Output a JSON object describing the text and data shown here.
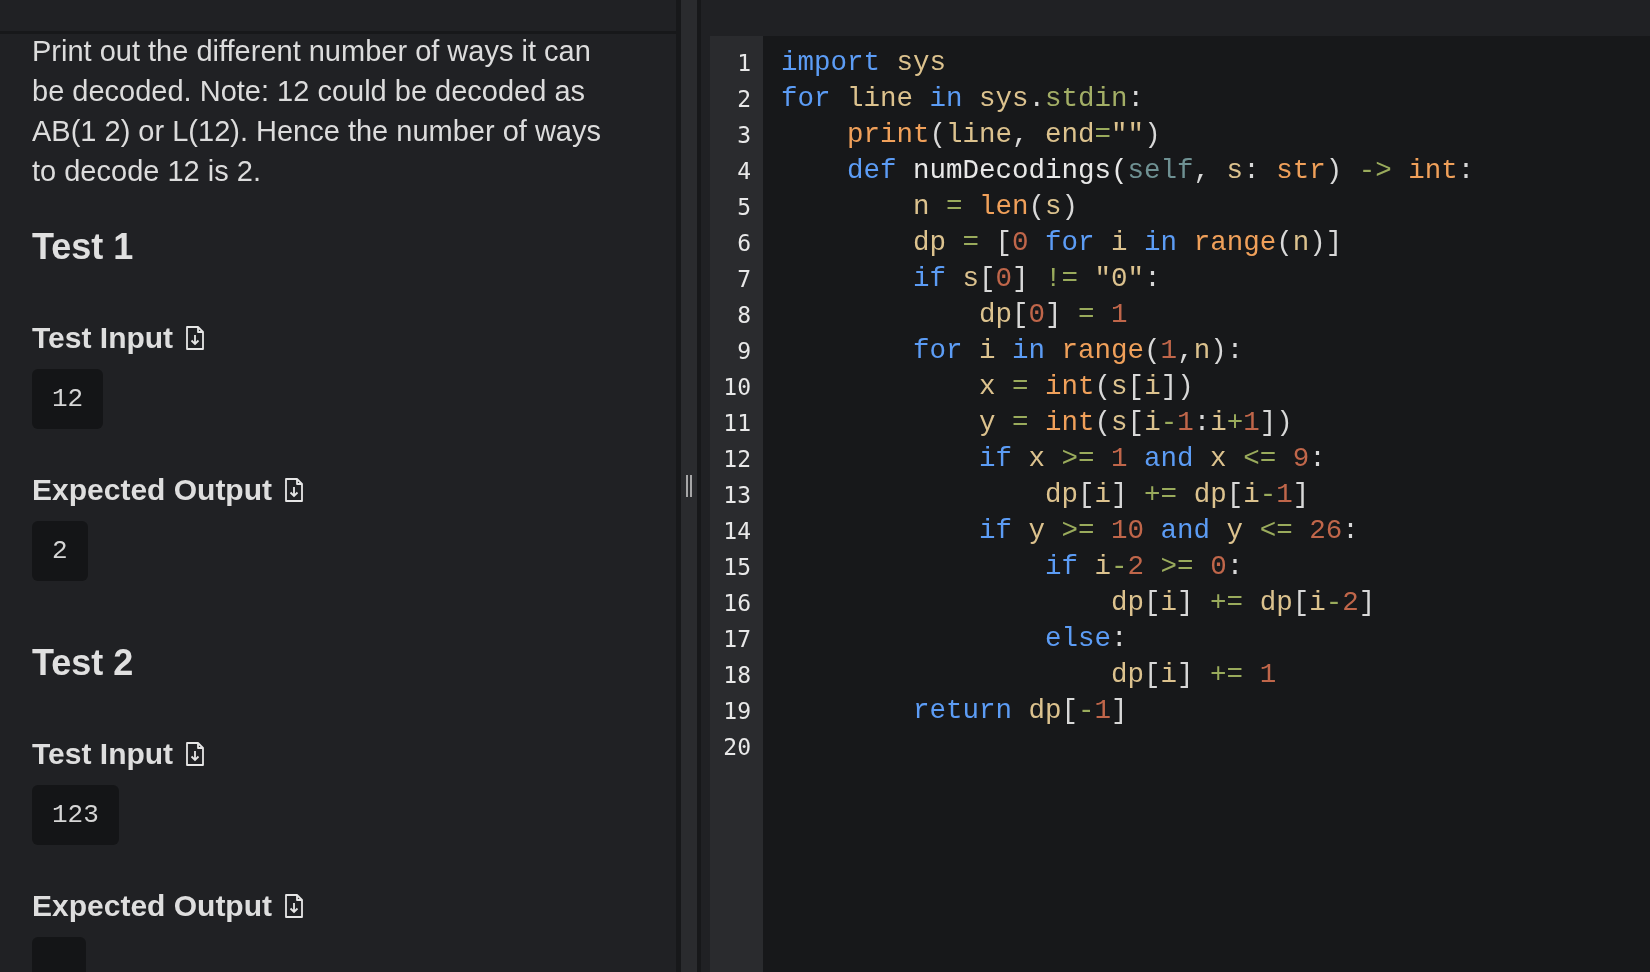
{
  "description": "Print out the different number of ways it can be decoded. Note: 12 could be decoded as AB(1 2) or L(12). Hence the number of ways to decode 12 is 2.",
  "tests": [
    {
      "title": "Test 1",
      "input_label": "Test Input",
      "input": "12",
      "output_label": "Expected Output",
      "output": "2"
    },
    {
      "title": "Test 2",
      "input_label": "Test Input",
      "input": "123",
      "output_label": "Expected Output"
    }
  ],
  "editor": {
    "lines": [
      {
        "number": "1",
        "tokens": [
          {
            "kind": "kw",
            "text": "import"
          },
          {
            "kind": "var",
            "text": " sys"
          }
        ]
      },
      {
        "number": "2",
        "tokens": [
          {
            "kind": "kw",
            "text": "for"
          },
          {
            "kind": "var",
            "text": " line"
          },
          {
            "kind": "kw",
            "text": " in"
          },
          {
            "kind": "var",
            "text": " sys"
          },
          {
            "kind": "punc",
            "text": "."
          },
          {
            "kind": "attr",
            "text": "stdin"
          },
          {
            "kind": "punc",
            "text": ":"
          }
        ]
      },
      {
        "number": "3",
        "tokens": [
          {
            "kind": "fn",
            "text": "    print"
          },
          {
            "kind": "punc",
            "text": "("
          },
          {
            "kind": "var",
            "text": "line"
          },
          {
            "kind": "punc",
            "text": ", "
          },
          {
            "kind": "var",
            "text": "end"
          },
          {
            "kind": "op",
            "text": "="
          },
          {
            "kind": "str",
            "text": "\"\""
          },
          {
            "kind": "punc",
            "text": ")"
          }
        ]
      },
      {
        "number": "4",
        "tokens": [
          {
            "kind": "kw",
            "text": "    def"
          },
          {
            "kind": "plain",
            "text": " numDecodings("
          },
          {
            "kind": "self",
            "text": "self"
          },
          {
            "kind": "punc",
            "text": ", "
          },
          {
            "kind": "var",
            "text": "s"
          },
          {
            "kind": "punc",
            "text": ": "
          },
          {
            "kind": "fn",
            "text": "str"
          },
          {
            "kind": "punc",
            "text": ") "
          },
          {
            "kind": "op",
            "text": "->"
          },
          {
            "kind": "fn",
            "text": " int"
          },
          {
            "kind": "punc",
            "text": ":"
          }
        ]
      },
      {
        "number": "5",
        "tokens": [
          {
            "kind": "var",
            "text": "        n"
          },
          {
            "kind": "op",
            "text": " ="
          },
          {
            "kind": "fn",
            "text": " len"
          },
          {
            "kind": "punc",
            "text": "("
          },
          {
            "kind": "var",
            "text": "s"
          },
          {
            "kind": "punc",
            "text": ")"
          }
        ]
      },
      {
        "number": "6",
        "tokens": [
          {
            "kind": "var",
            "text": "        dp"
          },
          {
            "kind": "op",
            "text": " ="
          },
          {
            "kind": "punc",
            "text": " ["
          },
          {
            "kind": "num",
            "text": "0"
          },
          {
            "kind": "kw",
            "text": " for"
          },
          {
            "kind": "var",
            "text": " i"
          },
          {
            "kind": "kw",
            "text": " in"
          },
          {
            "kind": "fn",
            "text": " range"
          },
          {
            "kind": "punc",
            "text": "("
          },
          {
            "kind": "var",
            "text": "n"
          },
          {
            "kind": "punc",
            "text": ")]"
          }
        ]
      },
      {
        "number": "7",
        "tokens": [
          {
            "kind": "kw",
            "text": "        if"
          },
          {
            "kind": "var",
            "text": " s"
          },
          {
            "kind": "punc",
            "text": "["
          },
          {
            "kind": "num",
            "text": "0"
          },
          {
            "kind": "punc",
            "text": "]"
          },
          {
            "kind": "op",
            "text": " !="
          },
          {
            "kind": "str",
            "text": " \"0\""
          },
          {
            "kind": "punc",
            "text": ":"
          }
        ]
      },
      {
        "number": "8",
        "tokens": [
          {
            "kind": "var",
            "text": "            dp"
          },
          {
            "kind": "punc",
            "text": "["
          },
          {
            "kind": "num",
            "text": "0"
          },
          {
            "kind": "punc",
            "text": "]"
          },
          {
            "kind": "op",
            "text": " ="
          },
          {
            "kind": "num",
            "text": " 1"
          }
        ]
      },
      {
        "number": "9",
        "tokens": [
          {
            "kind": "kw",
            "text": "        for"
          },
          {
            "kind": "var",
            "text": " i"
          },
          {
            "kind": "kw",
            "text": " in"
          },
          {
            "kind": "fn",
            "text": " range"
          },
          {
            "kind": "punc",
            "text": "("
          },
          {
            "kind": "num",
            "text": "1"
          },
          {
            "kind": "punc",
            "text": ","
          },
          {
            "kind": "var",
            "text": "n"
          },
          {
            "kind": "punc",
            "text": "):"
          }
        ]
      },
      {
        "number": "10",
        "tokens": [
          {
            "kind": "var",
            "text": "            x"
          },
          {
            "kind": "op",
            "text": " ="
          },
          {
            "kind": "fn",
            "text": " int"
          },
          {
            "kind": "punc",
            "text": "("
          },
          {
            "kind": "var",
            "text": "s"
          },
          {
            "kind": "punc",
            "text": "["
          },
          {
            "kind": "var",
            "text": "i"
          },
          {
            "kind": "punc",
            "text": "])"
          }
        ]
      },
      {
        "number": "11",
        "tokens": [
          {
            "kind": "var",
            "text": "            y"
          },
          {
            "kind": "op",
            "text": " ="
          },
          {
            "kind": "fn",
            "text": " int"
          },
          {
            "kind": "punc",
            "text": "("
          },
          {
            "kind": "var",
            "text": "s"
          },
          {
            "kind": "punc",
            "text": "["
          },
          {
            "kind": "var",
            "text": "i"
          },
          {
            "kind": "op",
            "text": "-"
          },
          {
            "kind": "num",
            "text": "1"
          },
          {
            "kind": "punc",
            "text": ":"
          },
          {
            "kind": "var",
            "text": "i"
          },
          {
            "kind": "op",
            "text": "+"
          },
          {
            "kind": "num",
            "text": "1"
          },
          {
            "kind": "punc",
            "text": "])"
          }
        ]
      },
      {
        "number": "12",
        "tokens": [
          {
            "kind": "kw",
            "text": "            if"
          },
          {
            "kind": "var",
            "text": " x"
          },
          {
            "kind": "op",
            "text": " >="
          },
          {
            "kind": "num",
            "text": " 1"
          },
          {
            "kind": "kw",
            "text": " and"
          },
          {
            "kind": "var",
            "text": " x"
          },
          {
            "kind": "op",
            "text": " <="
          },
          {
            "kind": "num",
            "text": " 9"
          },
          {
            "kind": "punc",
            "text": ":"
          }
        ]
      },
      {
        "number": "13",
        "tokens": [
          {
            "kind": "var",
            "text": "                dp"
          },
          {
            "kind": "punc",
            "text": "["
          },
          {
            "kind": "var",
            "text": "i"
          },
          {
            "kind": "punc",
            "text": "]"
          },
          {
            "kind": "op",
            "text": " +="
          },
          {
            "kind": "var",
            "text": " dp"
          },
          {
            "kind": "punc",
            "text": "["
          },
          {
            "kind": "var",
            "text": "i"
          },
          {
            "kind": "op",
            "text": "-"
          },
          {
            "kind": "num",
            "text": "1"
          },
          {
            "kind": "punc",
            "text": "]"
          }
        ]
      },
      {
        "number": "14",
        "tokens": [
          {
            "kind": "kw",
            "text": "            if"
          },
          {
            "kind": "var",
            "text": " y"
          },
          {
            "kind": "op",
            "text": " >="
          },
          {
            "kind": "num",
            "text": " 10"
          },
          {
            "kind": "kw",
            "text": " and"
          },
          {
            "kind": "var",
            "text": " y"
          },
          {
            "kind": "op",
            "text": " <="
          },
          {
            "kind": "num",
            "text": " 26"
          },
          {
            "kind": "punc",
            "text": ":"
          }
        ]
      },
      {
        "number": "15",
        "tokens": [
          {
            "kind": "kw",
            "text": "                if"
          },
          {
            "kind": "var",
            "text": " i"
          },
          {
            "kind": "op",
            "text": "-"
          },
          {
            "kind": "num",
            "text": "2"
          },
          {
            "kind": "op",
            "text": " >="
          },
          {
            "kind": "num",
            "text": " 0"
          },
          {
            "kind": "punc",
            "text": ":"
          }
        ]
      },
      {
        "number": "16",
        "tokens": [
          {
            "kind": "var",
            "text": "                    dp"
          },
          {
            "kind": "punc",
            "text": "["
          },
          {
            "kind": "var",
            "text": "i"
          },
          {
            "kind": "punc",
            "text": "]"
          },
          {
            "kind": "op",
            "text": " +="
          },
          {
            "kind": "var",
            "text": " dp"
          },
          {
            "kind": "punc",
            "text": "["
          },
          {
            "kind": "var",
            "text": "i"
          },
          {
            "kind": "op",
            "text": "-"
          },
          {
            "kind": "num",
            "text": "2"
          },
          {
            "kind": "punc",
            "text": "]"
          }
        ]
      },
      {
        "number": "17",
        "tokens": [
          {
            "kind": "kw",
            "text": "                else"
          },
          {
            "kind": "punc",
            "text": ":"
          }
        ]
      },
      {
        "number": "18",
        "tokens": [
          {
            "kind": "var",
            "text": "                    dp"
          },
          {
            "kind": "punc",
            "text": "["
          },
          {
            "kind": "var",
            "text": "i"
          },
          {
            "kind": "punc",
            "text": "]"
          },
          {
            "kind": "op",
            "text": " +="
          },
          {
            "kind": "num",
            "text": " 1"
          }
        ]
      },
      {
        "number": "19",
        "tokens": [
          {
            "kind": "kw",
            "text": "        return"
          },
          {
            "kind": "var",
            "text": " dp"
          },
          {
            "kind": "punc",
            "text": "["
          },
          {
            "kind": "op",
            "text": "-"
          },
          {
            "kind": "num",
            "text": "1"
          },
          {
            "kind": "punc",
            "text": "]"
          }
        ]
      },
      {
        "number": "20"
      }
    ]
  }
}
